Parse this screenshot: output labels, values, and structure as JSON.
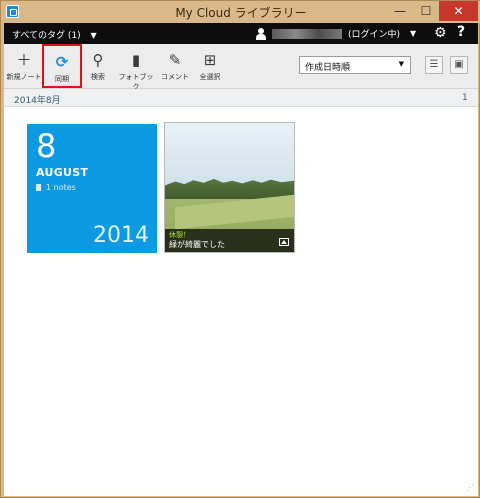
{
  "window": {
    "title": "My Cloud ライブラリー",
    "min_label": "—",
    "max_label": "☐",
    "close_label": "✕"
  },
  "topbar": {
    "tag_filter": "すべてのタグ (1)",
    "login_status": "(ログイン中)",
    "caret": "▼",
    "settings_icon": "gear-icon",
    "help_label": "?"
  },
  "toolbar": {
    "items": [
      {
        "label": "新規ノート",
        "icon": "plus-icon",
        "glyph": "＋"
      },
      {
        "label": "同期",
        "icon": "sync-icon",
        "glyph": "⟳"
      },
      {
        "label": "検索",
        "icon": "search-icon",
        "glyph": "⚲"
      },
      {
        "label": "フォトブック",
        "icon": "photobook-icon",
        "glyph": "▮"
      },
      {
        "label": "コメント",
        "icon": "comment-icon",
        "glyph": "✎"
      },
      {
        "label": "全選択",
        "icon": "select-all-icon",
        "glyph": "⊞"
      }
    ],
    "sort_value": "作成日時順",
    "list_view_glyph": "☰",
    "grid_view_glyph": "▣"
  },
  "month_group": {
    "label": "2014年8月",
    "count": "1"
  },
  "date_tile": {
    "day": "8",
    "month": "AUGUST",
    "notes": "1 notes",
    "year": "2014",
    "color": "#0e9ae2"
  },
  "note": {
    "caption_title": "休憩！",
    "caption_body": "緑が綺麗でした"
  },
  "colors": {
    "accent": "#0e9ae2",
    "highlight_border": "#e1101b",
    "window_frame": "#d9b98a"
  }
}
